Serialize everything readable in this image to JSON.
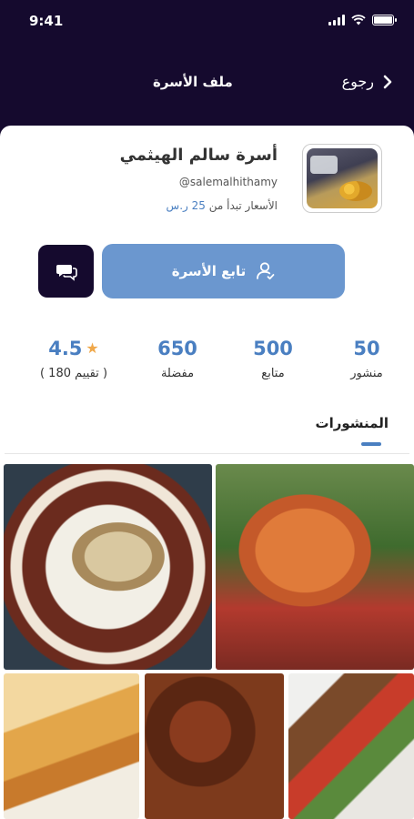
{
  "status_bar": {
    "time": "9:41"
  },
  "header": {
    "title": "ملف الأسرة",
    "back_label": "رجوع"
  },
  "profile": {
    "name": "أسرة سالم الهيثمي",
    "handle": "@salemalhithamy",
    "price_prefix": "الأسعار تبدأ من",
    "price_amount": "25 ر.س"
  },
  "actions": {
    "follow_label": "تابع الأسرة"
  },
  "stats": {
    "posts": {
      "value": "50",
      "label": "منشور"
    },
    "followers": {
      "value": "500",
      "label": "متابع"
    },
    "favorites": {
      "value": "650",
      "label": "مفضلة"
    },
    "rating": {
      "value": "4.5",
      "label": "( تقييم 180 )"
    }
  },
  "tabs": {
    "active": "المنشورات"
  },
  "colors": {
    "header_bg": "#150a2e",
    "accent": "#4a7fc1",
    "follow_btn": "#6b97cf",
    "star": "#f0a84a"
  },
  "icons": {
    "back": "chevron-right-icon",
    "follow": "add-user-icon",
    "message": "chat-bubble-icon",
    "rating": "star-icon"
  }
}
